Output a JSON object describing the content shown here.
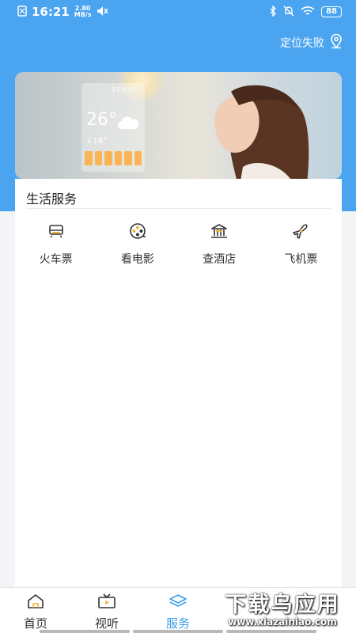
{
  "status_bar": {
    "time": "16:21",
    "speed_value": "2.80",
    "speed_unit": "MB/s",
    "battery": "88"
  },
  "header": {
    "location_label": "定位失败"
  },
  "banner": {
    "city": "SEOUL",
    "temperature": "26°",
    "low_temp": "↓18°"
  },
  "life_services": {
    "title": "生活服务",
    "items": [
      {
        "label": "火车票",
        "icon": "train-icon"
      },
      {
        "label": "看电影",
        "icon": "film-reel-icon"
      },
      {
        "label": "查酒店",
        "icon": "hotel-icon"
      },
      {
        "label": "飞机票",
        "icon": "airplane-icon"
      }
    ]
  },
  "bottom_nav": {
    "items": [
      {
        "label": "首页",
        "icon": "home-icon"
      },
      {
        "label": "视听",
        "icon": "tv-icon"
      },
      {
        "label": "服务",
        "icon": "layers-icon",
        "active": true
      },
      {
        "label": "",
        "icon": ""
      },
      {
        "label": "",
        "icon": ""
      }
    ]
  },
  "watermark": {
    "title": "下载乌应用",
    "url": "www.xiazainiao.com"
  },
  "colors": {
    "primary_blue": "#4aa4f0",
    "active_tab": "#3c9ee8",
    "icon_accent": "#f2b23a"
  }
}
